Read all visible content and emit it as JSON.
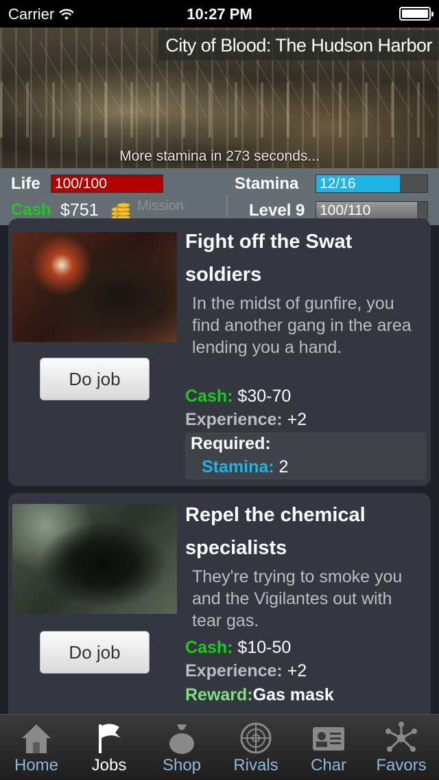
{
  "status_bar": {
    "carrier": "Carrier",
    "time": "10:27 PM"
  },
  "banner": {
    "title": "City of Blood: The Hudson Harbor",
    "stamina_timer": "More stamina in 273 seconds..."
  },
  "stats": {
    "life_label": "Life",
    "life_text": "100/100",
    "life_fraction": 1.0,
    "life_color": "#b00000",
    "stamina_label": "Stamina",
    "stamina_text": "12/16",
    "stamina_fraction": 0.75,
    "stamina_color": "#1eb4e6",
    "cash_label": "Cash",
    "cash_value": "$751",
    "level_label": "Level 9",
    "level_text": "100/110",
    "level_fraction": 0.909,
    "ghost_tab": "Mission"
  },
  "jobs": [
    {
      "title": "Fight off the Swat soldiers",
      "description": "In the midst of gunfire, you find another gang in the area lending you a hand.",
      "button": "Do job",
      "cash_label": "Cash:",
      "cash_value": "$30-70",
      "exp_label": "Experience:",
      "exp_value": "+2",
      "required_label": "Required:",
      "req_stamina_label": "Stamina:",
      "req_stamina_value": "2"
    },
    {
      "title": "Repel the chemical specialists",
      "description": "They're trying to smoke you and the Vigilantes out with tear gas.",
      "button": "Do job",
      "cash_label": "Cash:",
      "cash_value": "$10-50",
      "exp_label": "Experience:",
      "exp_value": "+2",
      "reward_label": "Reward:",
      "reward_value": "Gas mask"
    }
  ],
  "tabbar": {
    "items": [
      {
        "label": "Home",
        "icon": "home-icon"
      },
      {
        "label": "Jobs",
        "icon": "flag-icon"
      },
      {
        "label": "Shop",
        "icon": "money-bag-icon"
      },
      {
        "label": "Rivals",
        "icon": "radar-icon"
      },
      {
        "label": "Char",
        "icon": "id-card-icon"
      },
      {
        "label": "Favors",
        "icon": "network-icon"
      }
    ],
    "active": "Jobs"
  }
}
